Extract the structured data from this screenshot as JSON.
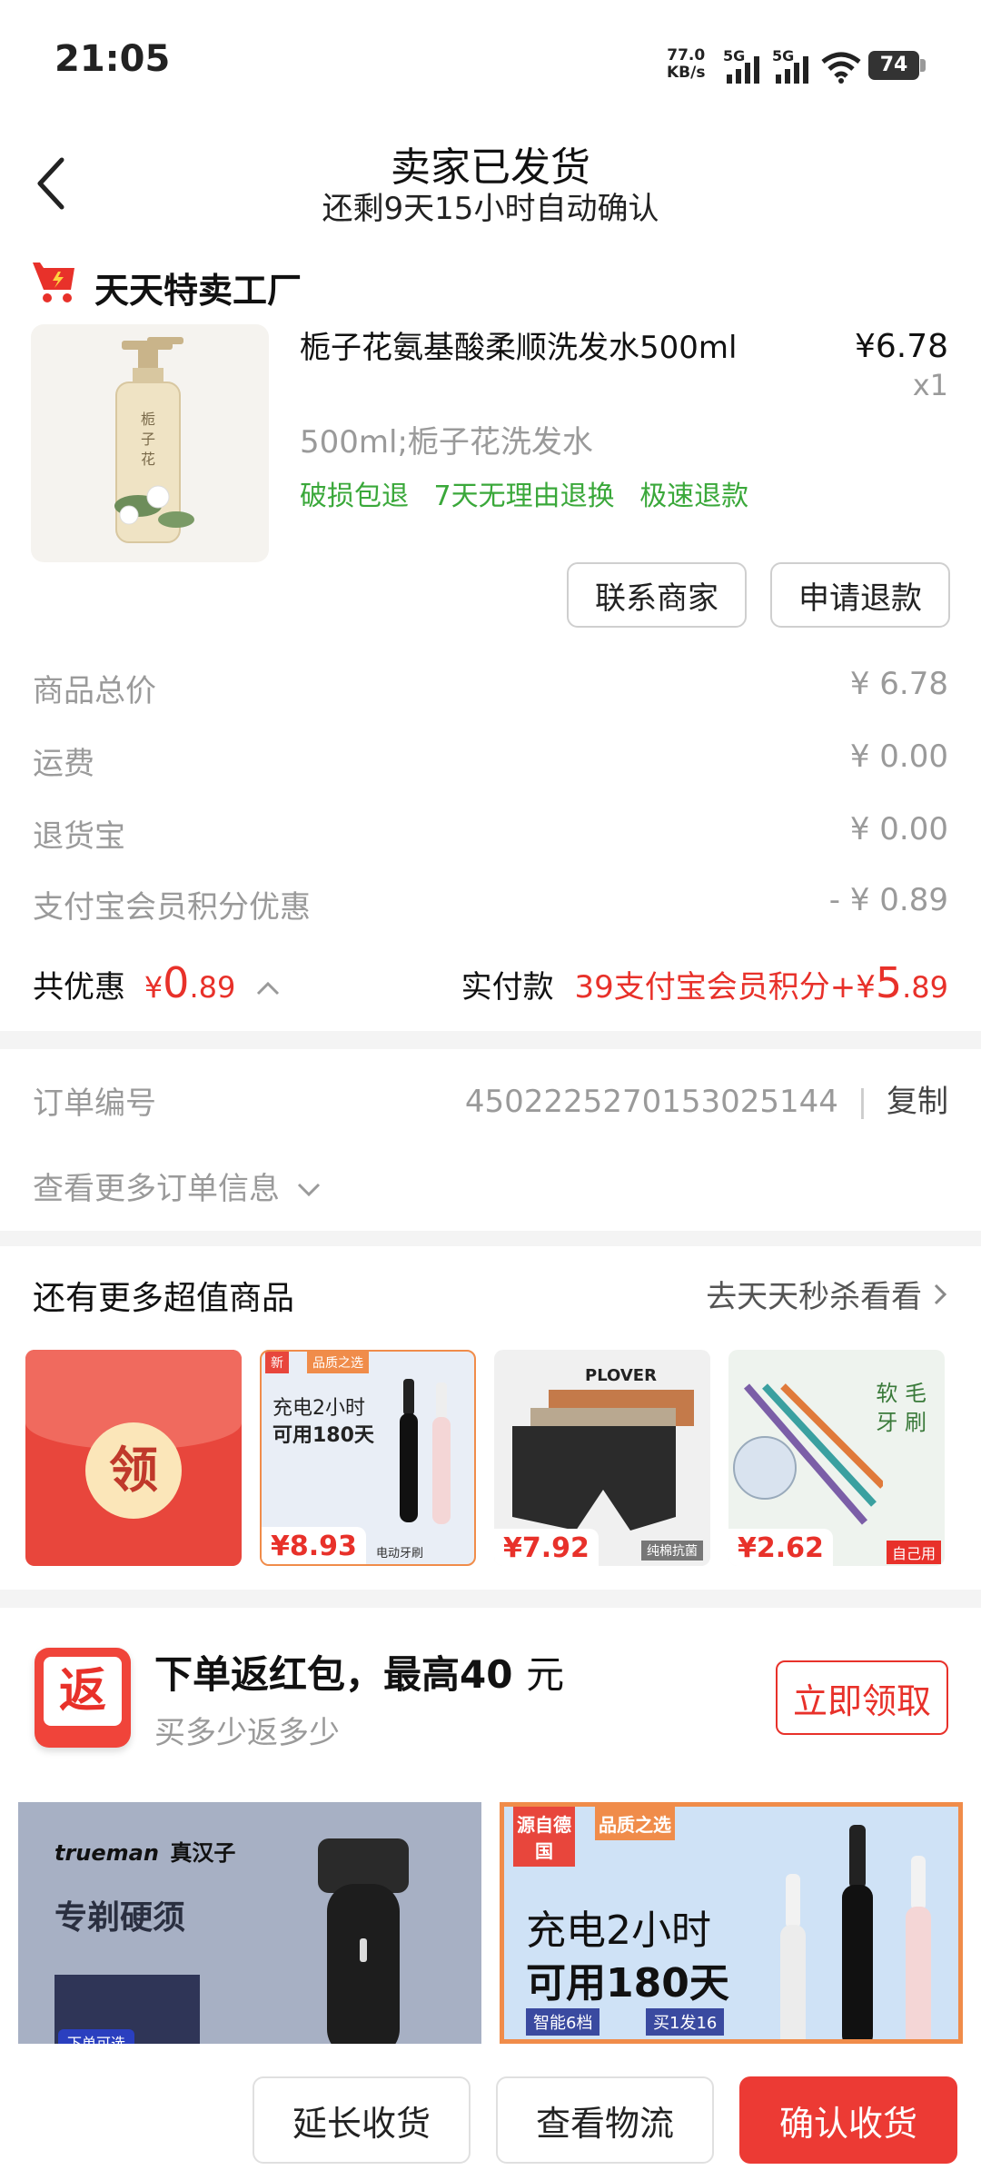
{
  "status_bar": {
    "time": "21:05",
    "net_speed_value": "77.0",
    "net_speed_unit": "KB/s",
    "sim1": "5G",
    "sim2": "5G",
    "battery": "74"
  },
  "header": {
    "title": "卖家已发货",
    "subtitle": "还剩9天15小时自动确认",
    "back_icon": "back-arrow-icon"
  },
  "shop": {
    "name": "天天特卖工厂",
    "icon": "shop-cart-icon",
    "icon_color": "#e8312a"
  },
  "product": {
    "title": "栀子花氨基酸柔顺洗发水500ml",
    "price": "¥6.78",
    "qty": "x1",
    "spec": "500ml;栀子花洗发水",
    "tags": [
      "破损包退",
      "7天无理由退换",
      "极速退款"
    ],
    "bottle_label": "栀子花"
  },
  "actions": {
    "contact": "联系商家",
    "refund": "申请退款"
  },
  "summary": {
    "rows": [
      {
        "label": "商品总价",
        "value": "¥ 6.78"
      },
      {
        "label": "运费",
        "value": "¥ 0.00"
      },
      {
        "label": "退货宝",
        "value": "¥ 0.00"
      },
      {
        "label": "支付宝会员积分优惠",
        "value": "- ¥ 0.89"
      }
    ],
    "discount_label": "共优惠",
    "discount_symbol": "¥",
    "discount_int": "0",
    "discount_dec": ".89",
    "paid_label": "实付款",
    "paid_points": "39支付宝会员积分+¥",
    "paid_int": "5",
    "paid_dec": ".89"
  },
  "order": {
    "label": "订单编号",
    "number": "4502225270153025144",
    "copy": "复制",
    "more": "查看更多订单信息"
  },
  "recommend": {
    "title": "还有更多超值商品",
    "more": "去天天秒杀看看",
    "coupon_text": "领",
    "items": [
      {
        "price": "¥8.93",
        "line1": "充电2小时",
        "line2": "可用180天",
        "badge1": "新",
        "badge2": "品质之选",
        "caption": "电动牙刷"
      },
      {
        "price": "¥7.92",
        "brand": "PLOVER",
        "caption": "纯棉抗菌"
      },
      {
        "price": "¥2.62",
        "line1": "软 毛",
        "line2": "牙 刷",
        "caption": "自己用"
      }
    ]
  },
  "red_packet": {
    "icon_text": "返",
    "title": "下单返红包，最高",
    "amount": "40",
    "unit": "元",
    "subtitle": "买多少返多少",
    "button": "立即领取"
  },
  "promos": {
    "left": {
      "brand": "trueman",
      "brand_cn": "真汉子",
      "headline": "专剃硬须",
      "tag": "下单可选"
    },
    "right": {
      "badge1": "源自德国",
      "badge2": "品质之选",
      "line1": "充电2小时",
      "line2": "可用180天",
      "chip1": "智能6档",
      "chip2": "买1发16"
    }
  },
  "bottom_bar": {
    "extend": "延长收货",
    "logistics": "查看物流",
    "confirm": "确认收货"
  },
  "colors": {
    "accent": "#e8312a",
    "tag_green": "#3aa83a",
    "muted": "#9a9a9a"
  }
}
